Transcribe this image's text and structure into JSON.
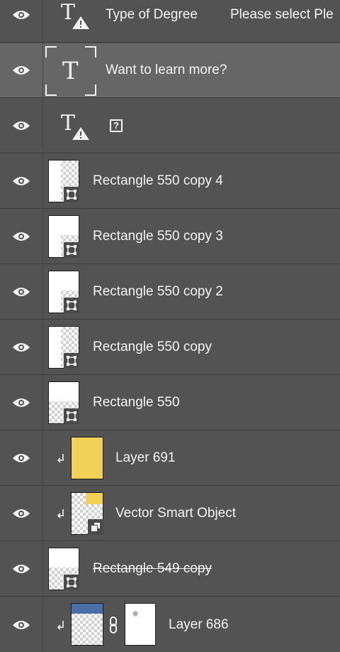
{
  "layers_panel": {
    "rows": [
      {
        "name": "Type of Degree",
        "name2": "Please select Ple",
        "kind": "text-warning"
      },
      {
        "name": "Want to learn more?",
        "kind": "text",
        "selected": true
      },
      {
        "name": "?",
        "kind": "text-warning"
      },
      {
        "name": "Rectangle 550 copy 4",
        "kind": "shape"
      },
      {
        "name": "Rectangle 550 copy 3",
        "kind": "shape"
      },
      {
        "name": "Rectangle 550 copy 2",
        "kind": "shape"
      },
      {
        "name": "Rectangle 550 copy",
        "kind": "shape"
      },
      {
        "name": "Rectangle 550",
        "kind": "shape"
      },
      {
        "name": "Layer 691",
        "kind": "pixel-clipped"
      },
      {
        "name": "Vector Smart Object",
        "kind": "smart-object-clipped"
      },
      {
        "name": "Rectangle 549 copy",
        "kind": "shape-disabled"
      },
      {
        "name": "Layer 686",
        "kind": "pixel-masked-clipped"
      }
    ]
  },
  "colors": {
    "panel_bg": "#535353",
    "selected_bg": "#666666",
    "divider": "#3d3d3d",
    "yellow_fill": "#f1d158",
    "blue_fill": "#4a6fa8"
  },
  "icons": {
    "visibility": "eye-icon",
    "text_layer": "text-layer-icon",
    "warning": "warning-icon",
    "shape_badge": "shape-badge-icon",
    "smart_object_badge": "smart-object-icon",
    "clipping": "clipping-arrow-icon",
    "link": "chain-link-icon"
  }
}
